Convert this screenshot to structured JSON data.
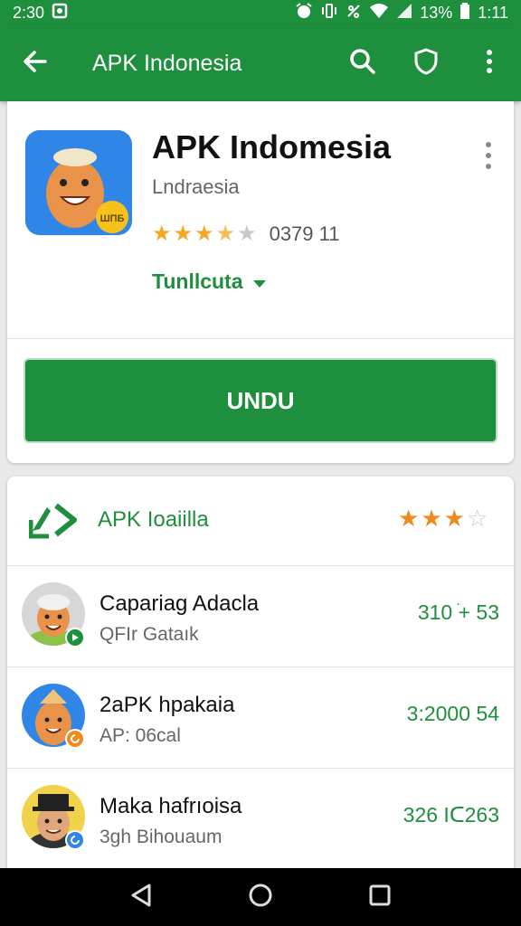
{
  "status_bar": {
    "time": "2:30",
    "battery_percent": "13%",
    "clock_right": "1:11"
  },
  "toolbar": {
    "title": "APK Indonesia",
    "icons": [
      "back-arrow-icon",
      "search-icon",
      "shield-icon",
      "more-vert-icon"
    ]
  },
  "app": {
    "title": "APK Indomesia",
    "developer": "Lndraesia",
    "rating": 3.5,
    "rating_count": "0379 11",
    "category": "Tunllcuta",
    "badge_text": "ШПБ",
    "install_label": "UNDU"
  },
  "list": {
    "header_title": "APK Ioaiilla",
    "header_rating": 3,
    "items": [
      {
        "title": "Capariag Adacla",
        "subtitle": "QFIr Gataık",
        "value": "310 ׁ+ 53",
        "avatar": "old-man"
      },
      {
        "title": "2aPK hpakaia",
        "subtitle": "AP: 06cal",
        "value": "3:2000 54",
        "avatar": "mascot"
      },
      {
        "title": "Maka hafrıoisa",
        "subtitle": "3gh Bihouaum",
        "value": "326 Iᑕ263",
        "avatar": "hat-man"
      }
    ]
  },
  "colors": {
    "brand_green": "#1e8f3c",
    "star_orange": "#f5a623",
    "app_icon_blue": "#2f86e6"
  }
}
